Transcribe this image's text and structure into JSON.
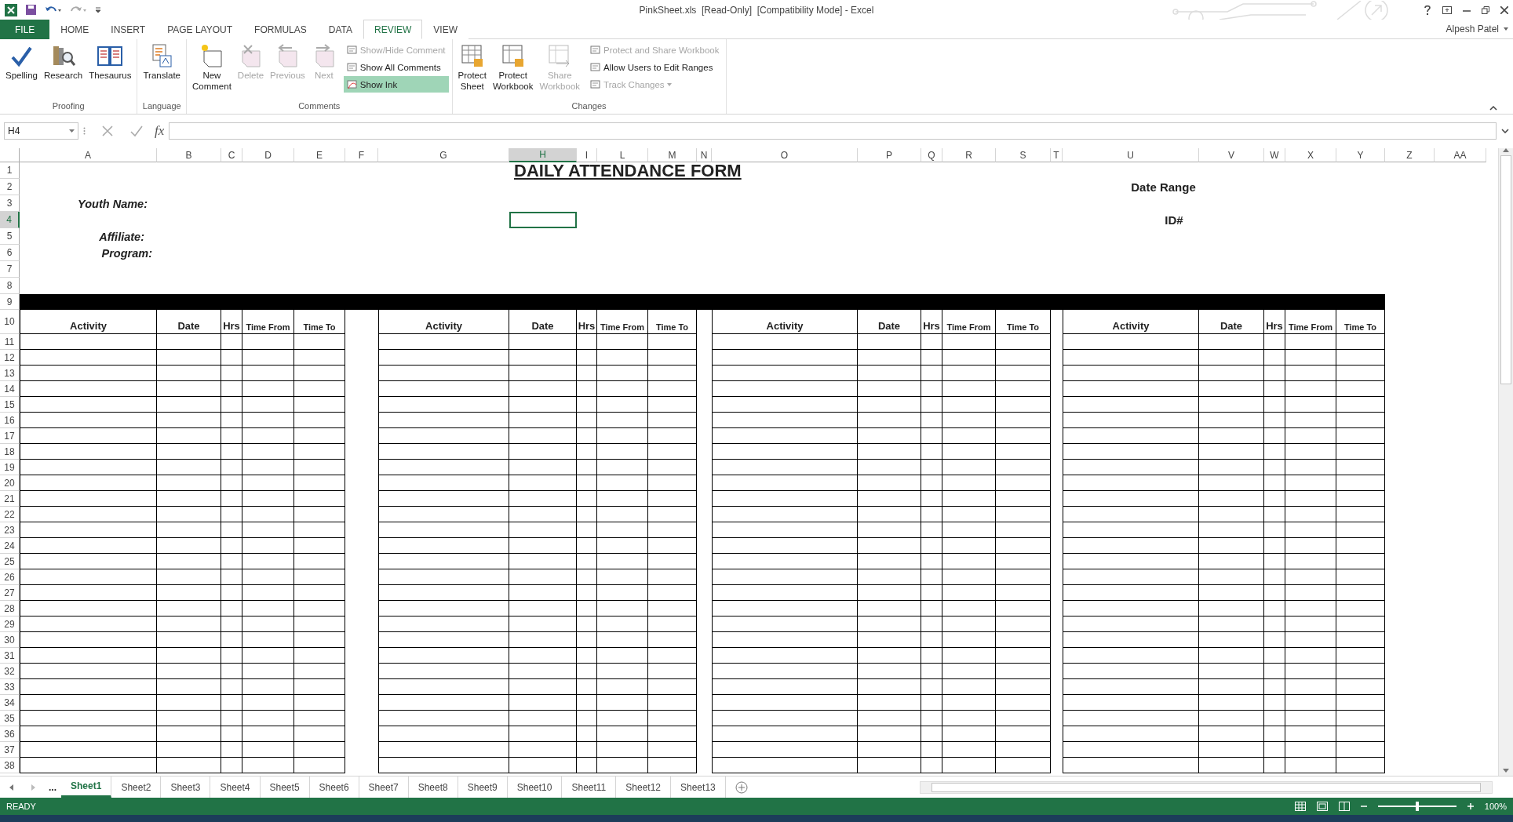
{
  "window": {
    "title": "PinkSheet.xls  [Read-Only]  [Compatibility Mode] - Excel",
    "user": "Alpesh Patel"
  },
  "ribbon_tabs": [
    {
      "label": "FILE",
      "kind": "file",
      "selected": false
    },
    {
      "label": "HOME",
      "kind": "tab",
      "selected": false
    },
    {
      "label": "INSERT",
      "kind": "tab",
      "selected": false
    },
    {
      "label": "PAGE LAYOUT",
      "kind": "tab",
      "selected": false
    },
    {
      "label": "FORMULAS",
      "kind": "tab",
      "selected": false
    },
    {
      "label": "DATA",
      "kind": "tab",
      "selected": false
    },
    {
      "label": "REVIEW",
      "kind": "tab",
      "selected": true
    },
    {
      "label": "VIEW",
      "kind": "tab",
      "selected": false
    }
  ],
  "ribbon_groups": [
    {
      "name": "Proofing",
      "buttons": [
        {
          "label": "Spelling",
          "kind": "large",
          "disabled": false,
          "selected": false
        },
        {
          "label": "Research",
          "kind": "large",
          "disabled": false,
          "selected": false
        },
        {
          "label": "Thesaurus",
          "kind": "large",
          "disabled": false,
          "selected": false
        }
      ]
    },
    {
      "name": "Language",
      "buttons": [
        {
          "label": "Translate",
          "kind": "large",
          "disabled": false,
          "selected": false
        }
      ]
    },
    {
      "name": "Comments",
      "buttons": [
        {
          "label": "New Comment",
          "kind": "large",
          "disabled": false,
          "selected": false
        },
        {
          "label": "Delete",
          "kind": "large",
          "disabled": true,
          "selected": false
        },
        {
          "label": "Previous",
          "kind": "large",
          "disabled": true,
          "selected": false
        },
        {
          "label": "Next",
          "kind": "large",
          "disabled": true,
          "selected": false
        },
        {
          "label": "Show/Hide Comment",
          "kind": "small",
          "disabled": true,
          "selected": false
        },
        {
          "label": "Show All Comments",
          "kind": "small",
          "disabled": false,
          "selected": false
        },
        {
          "label": "Show Ink",
          "kind": "small",
          "disabled": false,
          "selected": true
        }
      ]
    },
    {
      "name": "Changes",
      "buttons": [
        {
          "label": "Protect Sheet",
          "kind": "large",
          "disabled": false,
          "selected": false
        },
        {
          "label": "Protect Workbook",
          "kind": "large",
          "disabled": false,
          "selected": false
        },
        {
          "label": "Share Workbook",
          "kind": "large",
          "disabled": true,
          "selected": false
        },
        {
          "label": "Protect and Share Workbook",
          "kind": "small",
          "disabled": true,
          "selected": false
        },
        {
          "label": "Allow Users to Edit Ranges",
          "kind": "small",
          "disabled": false,
          "selected": false
        },
        {
          "label": "Track Changes",
          "kind": "menu",
          "disabled": true,
          "selected": false
        }
      ]
    }
  ],
  "formula_bar": {
    "name_box": "H4",
    "fx": "fx"
  },
  "columns": [
    {
      "label": "A",
      "selected": false
    },
    {
      "label": "B",
      "selected": false
    },
    {
      "label": "C",
      "selected": false
    },
    {
      "label": "D",
      "selected": false
    },
    {
      "label": "E",
      "selected": false
    },
    {
      "label": "F",
      "selected": false
    },
    {
      "label": "G",
      "selected": false
    },
    {
      "label": "H",
      "selected": true
    },
    {
      "label": "I",
      "selected": false
    },
    {
      "label": "L",
      "selected": false
    },
    {
      "label": "M",
      "selected": false
    },
    {
      "label": "N",
      "selected": false
    },
    {
      "label": "O",
      "selected": false
    },
    {
      "label": "P",
      "selected": false
    },
    {
      "label": "Q",
      "selected": false
    },
    {
      "label": "R",
      "selected": false
    },
    {
      "label": "S",
      "selected": false
    },
    {
      "label": "T",
      "selected": false
    },
    {
      "label": "U",
      "selected": false
    },
    {
      "label": "V",
      "selected": false
    },
    {
      "label": "W",
      "selected": false
    },
    {
      "label": "X",
      "selected": false
    },
    {
      "label": "Y",
      "selected": false
    },
    {
      "label": "Z",
      "selected": false
    },
    {
      "label": "AA",
      "selected": false
    }
  ],
  "rows": [
    {
      "label": "1",
      "selected": false
    },
    {
      "label": "2",
      "selected": false
    },
    {
      "label": "3",
      "selected": false
    },
    {
      "label": "4",
      "selected": true
    },
    {
      "label": "5",
      "selected": false
    },
    {
      "label": "6",
      "selected": false
    },
    {
      "label": "7",
      "selected": false
    },
    {
      "label": "8",
      "selected": false
    },
    {
      "label": "9",
      "selected": false
    },
    {
      "label": "10",
      "selected": false
    },
    {
      "label": "11",
      "selected": false
    },
    {
      "label": "12",
      "selected": false
    },
    {
      "label": "13",
      "selected": false
    },
    {
      "label": "14",
      "selected": false
    },
    {
      "label": "15",
      "selected": false
    },
    {
      "label": "16",
      "selected": false
    },
    {
      "label": "17",
      "selected": false
    },
    {
      "label": "18",
      "selected": false
    },
    {
      "label": "19",
      "selected": false
    },
    {
      "label": "20",
      "selected": false
    },
    {
      "label": "21",
      "selected": false
    },
    {
      "label": "22",
      "selected": false
    },
    {
      "label": "23",
      "selected": false
    },
    {
      "label": "24",
      "selected": false
    },
    {
      "label": "25",
      "selected": false
    },
    {
      "label": "26",
      "selected": false
    },
    {
      "label": "27",
      "selected": false
    },
    {
      "label": "28",
      "selected": false
    },
    {
      "label": "29",
      "selected": false
    },
    {
      "label": "30",
      "selected": false
    },
    {
      "label": "31",
      "selected": false
    },
    {
      "label": "32",
      "selected": false
    },
    {
      "label": "33",
      "selected": false
    },
    {
      "label": "34",
      "selected": false
    },
    {
      "label": "35",
      "selected": false
    },
    {
      "label": "36",
      "selected": false
    },
    {
      "label": "37",
      "selected": false
    },
    {
      "label": "38",
      "selected": false
    }
  ],
  "form": {
    "title": "DAILY ATTENDANCE FORM",
    "fields": [
      "Youth Name:",
      "Affiliate:",
      "Program:"
    ],
    "date_range": "Date Range",
    "id": "ID#",
    "blocks": [
      {
        "headers": [
          "Activity",
          "Date",
          "Hrs",
          "Time From",
          "Time To"
        ]
      },
      {
        "headers": [
          "Activity",
          "Date",
          "Hrs",
          "Time From",
          "Time To"
        ]
      },
      {
        "headers": [
          "Activity",
          "Date",
          "Hrs",
          "Time From",
          "Time To"
        ]
      },
      {
        "headers": [
          "Activity",
          "Date",
          "Hrs",
          "Time From",
          "Time To"
        ]
      }
    ]
  },
  "sheet_tabs": [
    {
      "label": "...",
      "kind": "more",
      "selected": false
    },
    {
      "label": "Sheet1",
      "kind": "sheet",
      "selected": true
    },
    {
      "label": "Sheet2",
      "kind": "sheet",
      "selected": false
    },
    {
      "label": "Sheet3",
      "kind": "sheet",
      "selected": false
    },
    {
      "label": "Sheet4",
      "kind": "sheet",
      "selected": false
    },
    {
      "label": "Sheet5",
      "kind": "sheet",
      "selected": false
    },
    {
      "label": "Sheet6",
      "kind": "sheet",
      "selected": false
    },
    {
      "label": "Sheet7",
      "kind": "sheet",
      "selected": false
    },
    {
      "label": "Sheet8",
      "kind": "sheet",
      "selected": false
    },
    {
      "label": "Sheet9",
      "kind": "sheet",
      "selected": false
    },
    {
      "label": "Sheet10",
      "kind": "sheet",
      "selected": false
    },
    {
      "label": "Sheet11",
      "kind": "sheet",
      "selected": false
    },
    {
      "label": "Sheet12",
      "kind": "sheet",
      "selected": false
    },
    {
      "label": "Sheet13",
      "kind": "sheet",
      "selected": false
    }
  ],
  "status_bar": {
    "status": "READY",
    "zoom": "100%",
    "zoom_slider": {
      "level": 0.5
    }
  }
}
